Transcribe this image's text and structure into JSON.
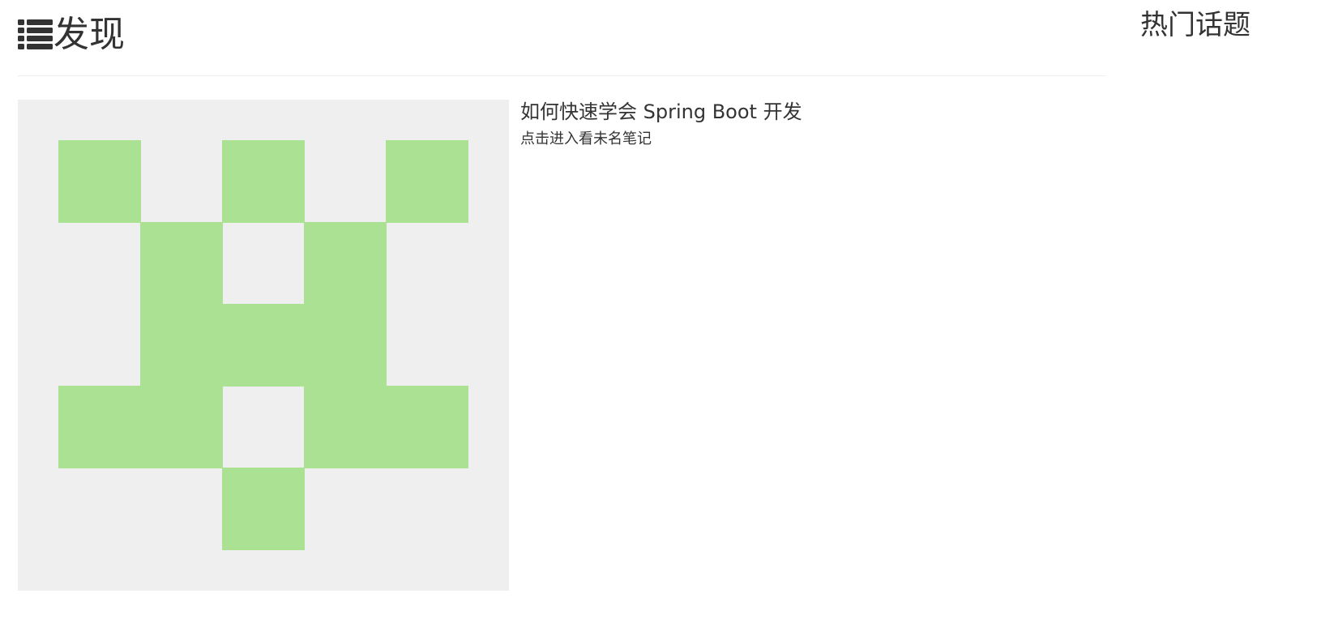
{
  "main": {
    "heading": "发现",
    "heading_icon": "list-icon",
    "posts": [
      {
        "title": "如何快速学会 Spring Boot 开发",
        "description": "点击进入看未名笔记",
        "avatar_icon": "identicon",
        "avatar_color": "#aae193",
        "avatar_background": "#efefef"
      }
    ]
  },
  "sidebar": {
    "heading": "热门话题"
  }
}
